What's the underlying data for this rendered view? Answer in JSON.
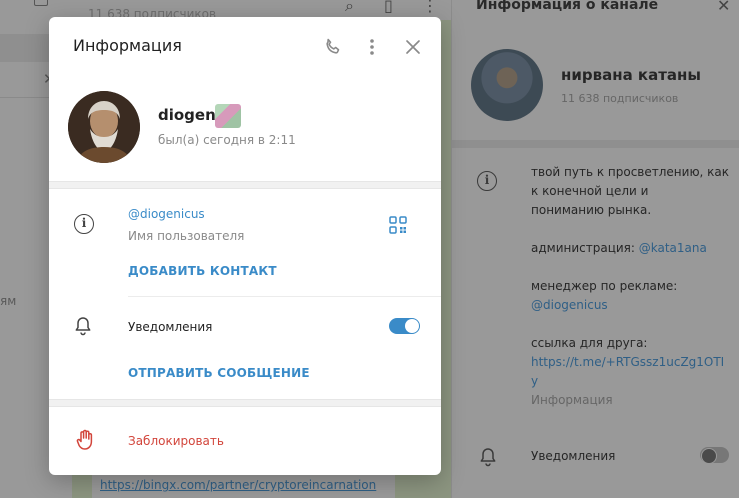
{
  "background": {
    "chat": {
      "subscribers_partial": "11 638 подписчиков",
      "link_partial": "https://bingx.com/partner/cryptoreincarnation"
    },
    "left_fragment_text": "ям",
    "channel_panel": {
      "title": "Информация о канале",
      "channel_name": "нирвана катаны",
      "subscribers": "11 638 подписчиков",
      "description_lines": [
        "твой путь к просветлению, как",
        "к конечной цели и",
        "пониманию рынка."
      ],
      "admin_label": "администрация: ",
      "admin_link": "@kata1ana",
      "manager_label": "менеджер по рекламе:",
      "manager_link": "@diogenicus",
      "friend_label": "ссылка для друга:",
      "friend_link_line1": "https://t.me/+RTGssz1ucZg1OTI",
      "friend_link_line2": "y",
      "info_caption": "Информация",
      "notifications_label": "Уведомления",
      "notifications_enabled": false
    }
  },
  "modal": {
    "title": "Информация",
    "icons": {
      "call": "phone-icon",
      "more": "more-vertical-icon",
      "close": "close-icon"
    },
    "user": {
      "name": "diogen",
      "status": "был(а) сегодня в 2:11"
    },
    "username": {
      "value": "@diogenicus",
      "caption": "Имя пользователя"
    },
    "add_contact_label": "ДОБАВИТЬ КОНТАКТ",
    "notifications": {
      "label": "Уведомления",
      "enabled": true
    },
    "send_message_label": "ОТПРАВИТЬ СООБЩЕНИЕ",
    "block_label": "Заблокировать",
    "colors": {
      "accent": "#3a8bc8",
      "danger": "#d2453b"
    }
  }
}
